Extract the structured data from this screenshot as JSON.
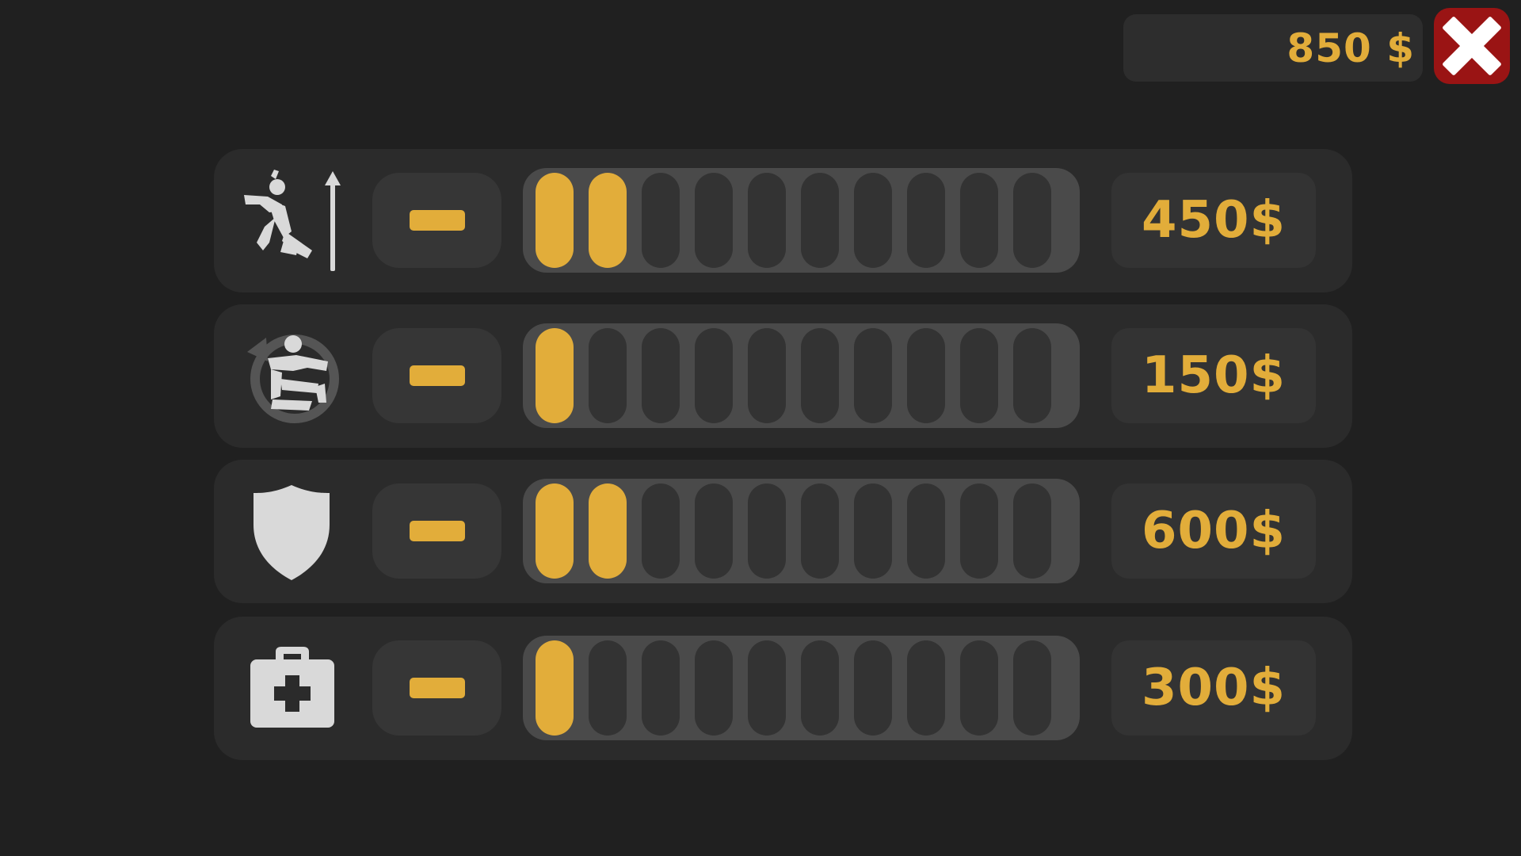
{
  "wallet": {
    "balance": "850 $"
  },
  "close": {
    "icon": "close-icon",
    "color": "#9a1414"
  },
  "colors": {
    "accent": "#e2ad3a",
    "background": "#202020",
    "panel": "#2b2b2b",
    "segment_empty": "#333333",
    "icon": "#d9d9d9"
  },
  "upgrades": [
    {
      "id": "jump",
      "icon": "high-jump-icon",
      "level": 2,
      "max_level": 10,
      "decrease_icon": "minus-icon",
      "price": "450$"
    },
    {
      "id": "spin",
      "icon": "spin-kick-icon",
      "level": 1,
      "max_level": 10,
      "decrease_icon": "minus-icon",
      "price": "150$"
    },
    {
      "id": "armor",
      "icon": "shield-icon",
      "level": 2,
      "max_level": 10,
      "decrease_icon": "minus-icon",
      "price": "600$"
    },
    {
      "id": "health",
      "icon": "medkit-icon",
      "level": 1,
      "max_level": 10,
      "decrease_icon": "minus-icon",
      "price": "300$"
    }
  ]
}
